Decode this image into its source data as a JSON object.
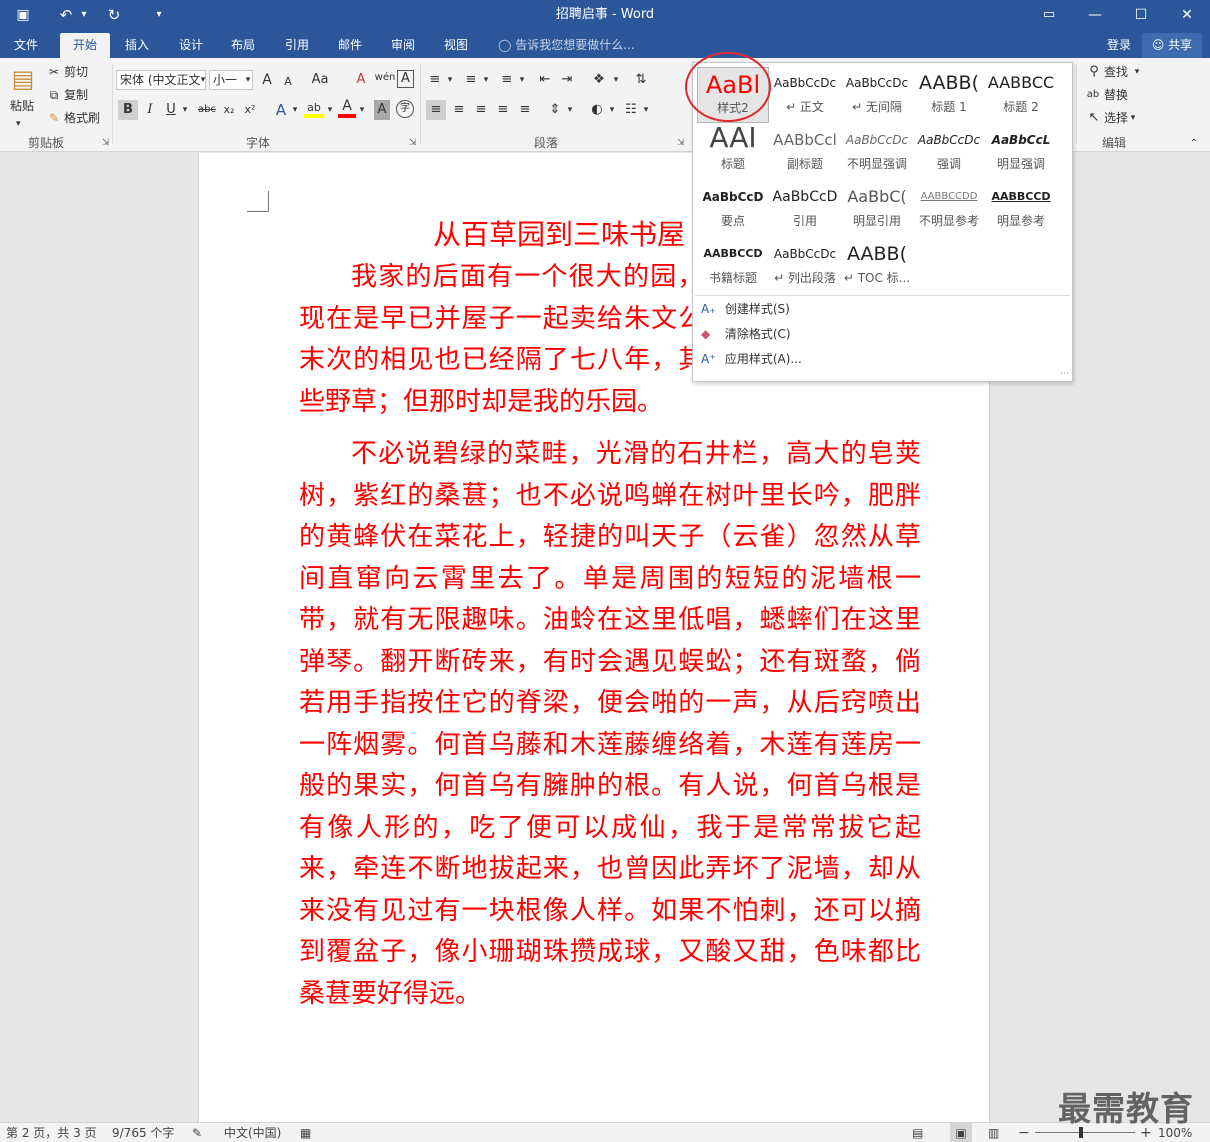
{
  "window": {
    "title": "招聘启事 - Word",
    "quick_access": {
      "save": "💾",
      "undo": "↶",
      "undo_drop": "▾",
      "redo": "↻",
      "customize": "▾"
    },
    "controls": {
      "ribbon_display": "▭",
      "minimize": "—",
      "maximize": "☐",
      "close": "✕"
    }
  },
  "tabs": [
    "文件",
    "开始",
    "插入",
    "设计",
    "布局",
    "引用",
    "邮件",
    "审阅",
    "视图"
  ],
  "active_tab": "开始",
  "tellme_placeholder": "告诉我您想要做什么...",
  "account": {
    "login": "登录",
    "share": "共享"
  },
  "clipboard": {
    "paste": "粘贴",
    "cut": "剪切",
    "copy": "复制",
    "format_painter": "格式刷",
    "label": "剪贴板"
  },
  "font": {
    "name": "宋体 (中文正文",
    "size": "小一",
    "grow": "A",
    "shrink": "A",
    "case": "Aa",
    "clear": "A",
    "phonetic": "wén",
    "border_char": "A",
    "bold": "B",
    "italic": "I",
    "underline": "U",
    "strike": "abc",
    "subscript": "x₂",
    "superscript": "x²",
    "effects": "A",
    "highlight": "ab",
    "color": "A",
    "shading": "A",
    "enclose": "字",
    "label": "字体"
  },
  "paragraph": {
    "label": "段落"
  },
  "editing": {
    "find": "查找",
    "replace": "替换",
    "select": "选择",
    "label": "编辑"
  },
  "style_gallery": {
    "items": [
      {
        "sample": "AaBl",
        "name": "样式2"
      },
      {
        "sample": "AaBbCcDc",
        "name": "↵ 正文"
      },
      {
        "sample": "AaBbCcDc",
        "name": "↵ 无间隔"
      },
      {
        "sample": "AABB(",
        "name": "标题 1"
      },
      {
        "sample": "AABBCC",
        "name": "标题 2"
      },
      {
        "sample": "AAI",
        "name": "标题"
      },
      {
        "sample": "AABbCcl",
        "name": "副标题"
      },
      {
        "sample": "AaBbCcDc",
        "name": "不明显强调"
      },
      {
        "sample": "AaBbCcDc",
        "name": "强调"
      },
      {
        "sample": "AaBbCcL",
        "name": "明显强调"
      },
      {
        "sample": "AaBbCcD",
        "name": "要点"
      },
      {
        "sample": "AaBbCcD",
        "name": "引用"
      },
      {
        "sample": "AaBbC(",
        "name": "明显引用"
      },
      {
        "sample": "AABBCCDD",
        "name": "不明显参考"
      },
      {
        "sample": "AABBCCD",
        "name": "明显参考"
      },
      {
        "sample": "AABBCCD",
        "name": "书籍标题"
      },
      {
        "sample": "AaBbCcDc",
        "name": "↵ 列出段落"
      },
      {
        "sample": "AABB(",
        "name": "↵ TOC 标..."
      }
    ],
    "commands": [
      {
        "label": "创建样式(S)",
        "icon": "A₊"
      },
      {
        "label": "清除格式(C)",
        "icon": "◆"
      },
      {
        "label": "应用样式(A)...",
        "icon": "A⁺"
      }
    ],
    "accent": "#e0282a"
  },
  "document": {
    "title": "从百草园到三味书屋",
    "paragraphs": [
      "我家的后面有一个很大的园，相传叫作百草园。现在是早已并屋子一起卖给朱文公的子孙了，连那最末次的相见也已经隔了七八年，其中似乎确凿只有一些野草；但那时却是我的乐园。",
      "不必说碧绿的菜畦，光滑的石井栏，高大的皂荚树，紫红的桑葚；也不必说鸣蝉在树叶里长吟，肥胖的黄蜂伏在菜花上，轻捷的叫天子（云雀）忽然从草间直窜向云霄里去了。单是周围的短短的泥墙根一带，就有无限趣味。油蛉在这里低唱，蟋蟀们在这里弹琴。翻开断砖来，有时会遇见蜈蚣；还有斑蝥，倘若用手指按住它的脊梁，便会啪的一声，从后窍喷出一阵烟雾。何首乌藤和木莲藤缠络着，木莲有莲房一般的果实，何首乌有臃肿的根。有人说，何首乌根是有像人形的，吃了便可以成仙，我于是常常拔它起来，牵连不断地拔起来，也曾因此弄坏了泥墙，却从来没有见过有一块根像人样。如果不怕刺，还可以摘到覆盆子，像小珊瑚珠攒成球，又酸又甜，色味都比桑葚要好得远。"
    ],
    "text_color": "#ff0000"
  },
  "status": {
    "page": "第 2 页，共 3 页",
    "words": "9/765 个字",
    "language": "中文(中国)",
    "zoom": "100%",
    "zoom_minus": "−",
    "zoom_plus": "+",
    "zoom_level": 1.0
  },
  "watermark": "最需教育"
}
